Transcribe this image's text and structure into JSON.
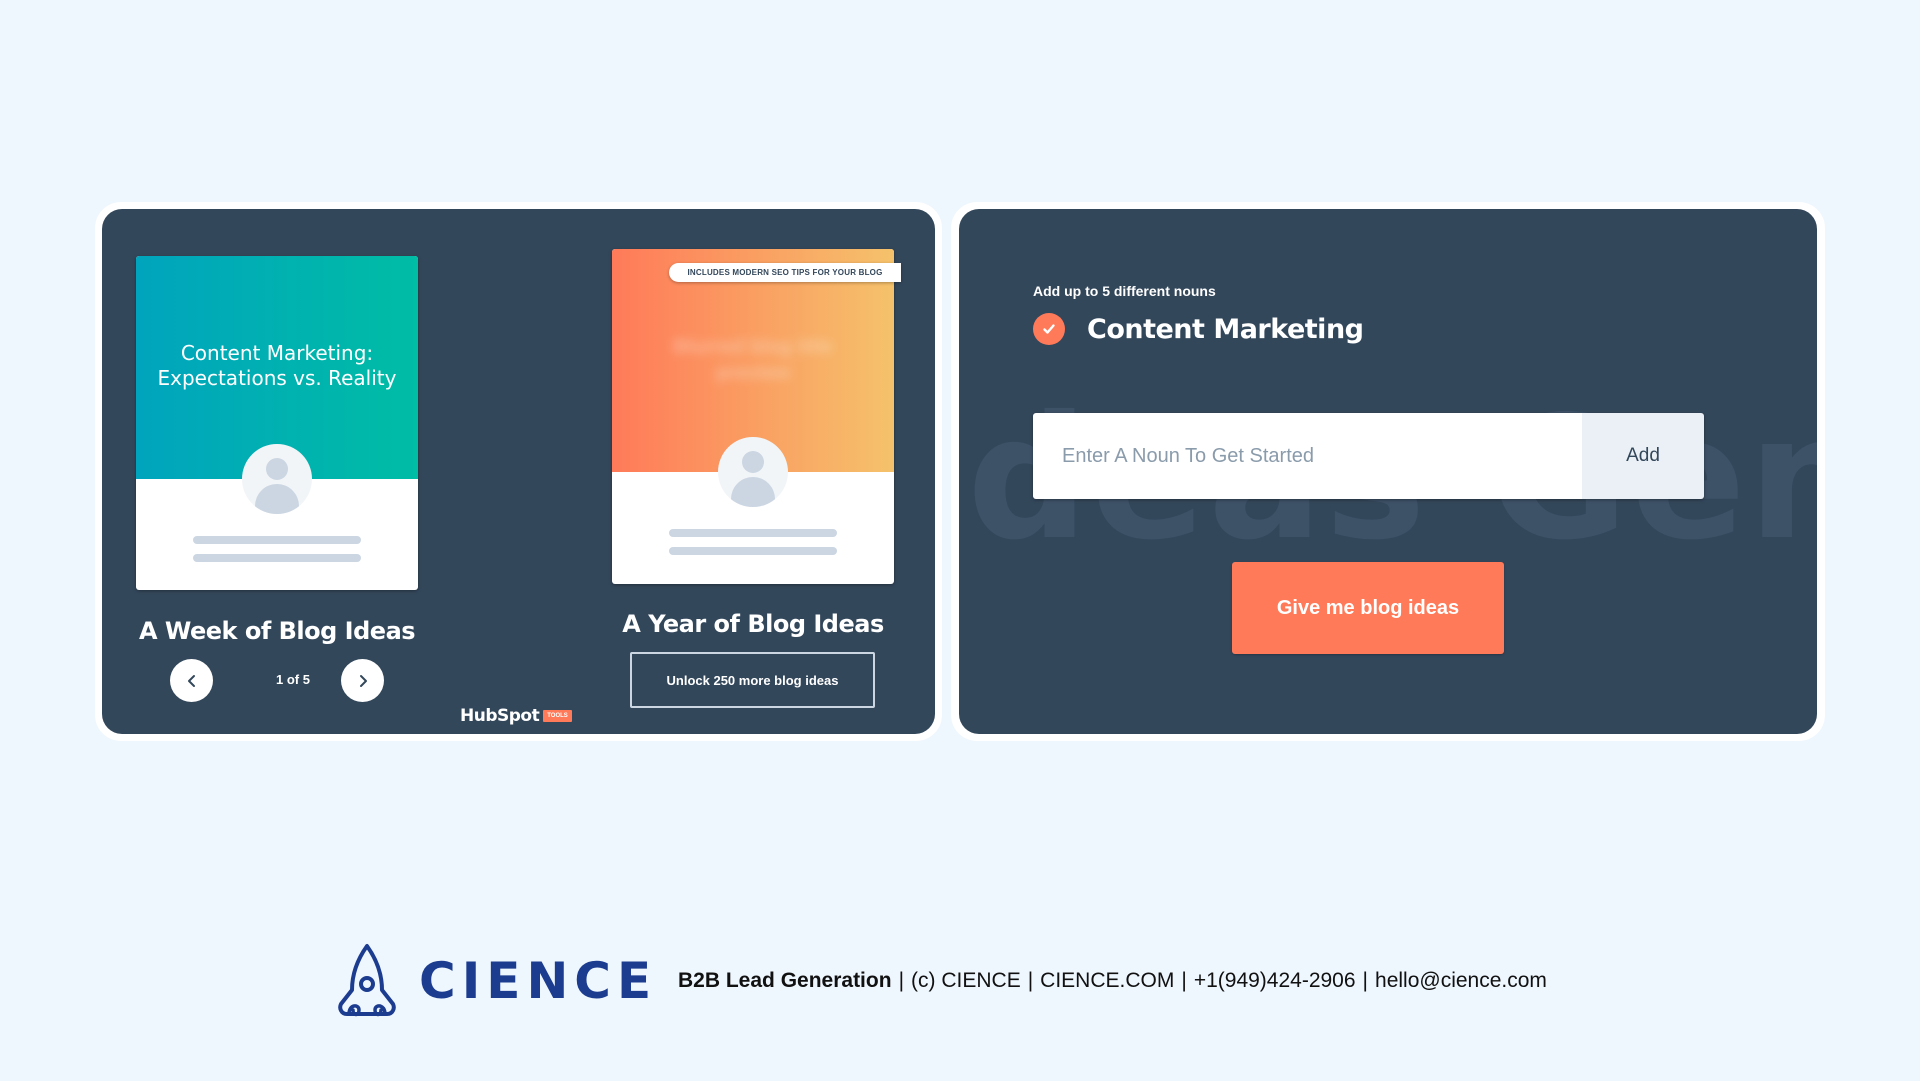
{
  "left_panel": {
    "week_card": {
      "hero_title_line1": "Content Marketing:",
      "hero_title_line2": "Expectations vs. Reality",
      "hero_gradient": [
        "#00a4bd",
        "#00bda5"
      ]
    },
    "week_title": "A Week of Blog Ideas",
    "pager": {
      "prev_icon": "chevron-left-icon",
      "text": "1 of 5",
      "next_icon": "chevron-right-icon"
    },
    "year_card": {
      "badge": "INCLUDES MODERN SEO TIPS FOR YOUR BLOG",
      "blurred_title": "Blurred blog title preview",
      "hero_gradient": [
        "#ff7a59",
        "#f5c26b"
      ]
    },
    "year_title": "A Year of Blog Ideas",
    "unlock_button": "Unlock 250 more blog ideas",
    "brand": {
      "name": "HubSpot",
      "tag": "TOOLS"
    }
  },
  "right_panel": {
    "watermark": "deas Gene",
    "hint": "Add up to 5 different nouns",
    "nouns": [
      {
        "label": "Content Marketing",
        "icon": "check-circle-icon"
      }
    ],
    "input": {
      "value": "",
      "placeholder": "Enter A Noun To Get Started"
    },
    "add_button": "Add",
    "submit_button": "Give me blog ideas"
  },
  "footer": {
    "logo_text": "CIENCE",
    "tagline": "B2B Lead Generation",
    "copyright": "(c) CIENCE",
    "website": "CIENCE.COM",
    "phone": "+1(949)424-2906",
    "email": "hello@cience.com"
  },
  "colors": {
    "page_bg": "#eef6fe",
    "panel_bg": "#33475b",
    "accent": "#ff7a59",
    "logo": "#1c3c8f"
  }
}
